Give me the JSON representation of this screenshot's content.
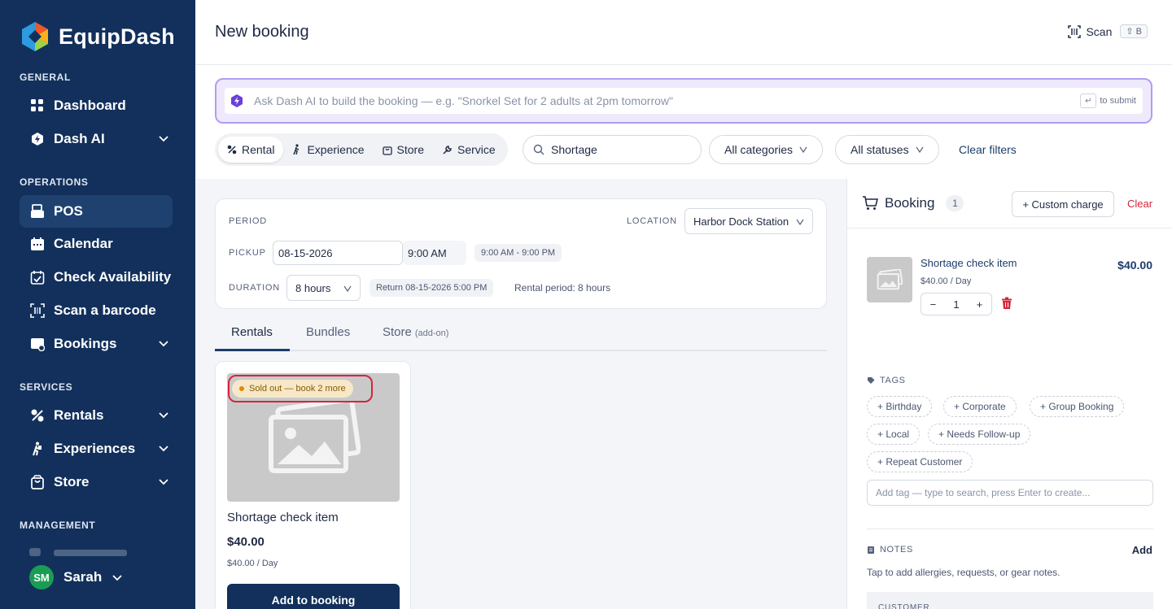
{
  "app": {
    "name": "EquipDash"
  },
  "sidebar": {
    "sections": {
      "general": "GENERAL",
      "operations": "OPERATIONS",
      "services": "SERVICES",
      "management": "MANAGEMENT"
    },
    "items": {
      "dashboard": "Dashboard",
      "dash_ai": "Dash AI",
      "pos": "POS",
      "calendar": "Calendar",
      "check_availability": "Check Availability",
      "scan_barcode": "Scan a barcode",
      "bookings": "Bookings",
      "rentals": "Rentals",
      "experiences": "Experiences",
      "store": "Store"
    },
    "user": {
      "initials": "SM",
      "name": "Sarah"
    }
  },
  "header": {
    "title": "New booking",
    "scan_label": "Scan",
    "scan_shortcut": "⇧ B"
  },
  "ai": {
    "placeholder": "Ask Dash AI to build the booking — e.g. \"Snorkel Set for 2 adults at 2pm tomorrow\"",
    "submit_hint": "to submit"
  },
  "filters": {
    "types": [
      "Rental",
      "Experience",
      "Store",
      "Service"
    ],
    "search_value": "Shortage",
    "categories": "All categories",
    "statuses": "All statuses",
    "clear": "Clear filters"
  },
  "period": {
    "period_label": "PERIOD",
    "location_label": "LOCATION",
    "location_value": "Harbor Dock Station",
    "pickup_label": "PICKUP",
    "pickup_date": "08-15-2026",
    "pickup_time": "9:00 AM",
    "hours": "9:00 AM - 9:00 PM",
    "duration_label": "DURATION",
    "duration_value": "8 hours",
    "return_text": "Return 08-15-2026 5:00 PM",
    "rental_period": "Rental period: 8 hours"
  },
  "tabs": {
    "rentals": "Rentals",
    "bundles": "Bundles",
    "store": "Store",
    "store_sub": "(add-on)"
  },
  "product": {
    "badge": "Sold out — book 2 more",
    "name": "Shortage check item",
    "price": "$40.00",
    "rate": "$40.00 / Day",
    "add_label": "Add to booking"
  },
  "booking": {
    "title": "Booking",
    "count": "1",
    "custom_charge": "+ Custom charge",
    "clear": "Clear",
    "line_item": {
      "name": "Shortage check item",
      "price": "$40.00",
      "rate": "$40.00 / Day",
      "qty": "1"
    },
    "tags_label": "TAGS",
    "tags": [
      "+ Birthday",
      "+ Corporate",
      "+ Group Booking",
      "+ Local",
      "+ Needs Follow-up",
      "+ Repeat Customer"
    ],
    "tag_placeholder": "Add tag — type to search, press Enter to create...",
    "notes_label": "NOTES",
    "notes_add": "Add",
    "notes_hint": "Tap to add allergies, requests, or gear notes.",
    "customer_label": "CUSTOMER"
  },
  "colors": {
    "sidebar": "#12305b",
    "accent_purple": "#b39cf0",
    "danger": "#d3263c"
  }
}
